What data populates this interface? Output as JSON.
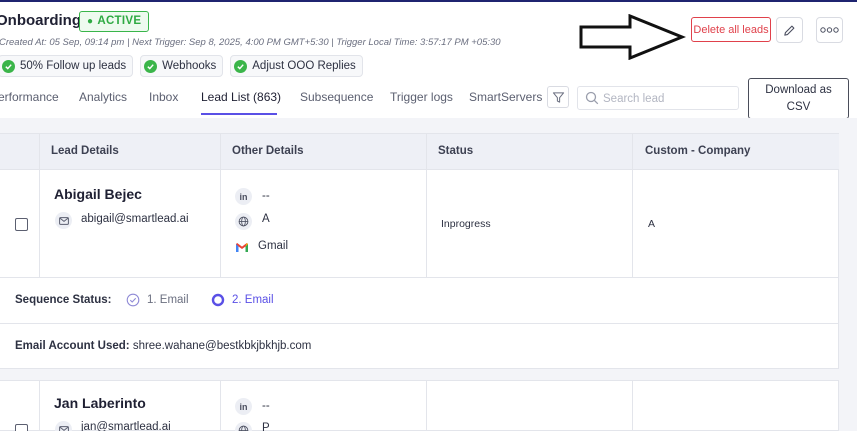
{
  "header": {
    "title": "Onboarding",
    "status_badge": "ACTIVE",
    "meta": "Created At: 05 Sep, 09:14 pm | Next Trigger: Sep 8, 2025, 4:00 PM GMT+5:30 | Trigger Local Time: 3:57:17 PM +05:30",
    "chips": [
      "50% Follow up leads",
      "Webhooks",
      "Adjust OOO Replies"
    ],
    "delete_label": "Delete all leads"
  },
  "tabs": [
    "erformance",
    "Analytics",
    "Inbox",
    "Lead List (863)",
    "Subsequence",
    "Trigger logs",
    "SmartServers"
  ],
  "active_tab": "Lead List (863)",
  "search": {
    "placeholder": "Search lead",
    "value": ""
  },
  "download_label_1": "Download as",
  "download_label_2": "CSV",
  "table": {
    "columns": [
      "Lead Details",
      "Other Details",
      "Status",
      "Custom - Company"
    ],
    "rows": [
      {
        "name": "Abigail Bejec",
        "email": "abigail@smartlead.ai",
        "linkedin": "--",
        "website": "A",
        "provider": "Gmail",
        "status": "Inprogress",
        "company": "A",
        "sequence_label": "Sequence Status:",
        "sequence_steps": [
          "1. Email",
          "2. Email"
        ],
        "email_account_label": "Email Account Used:",
        "email_account": "shree.wahane@bestkbkjbkhjb.com"
      },
      {
        "name": "Jan Laberinto",
        "email": "jan@smartlead.ai",
        "linkedin": "--",
        "website": "P"
      }
    ]
  },
  "colors": {
    "accent": "#5a50e6",
    "active_green": "#39b54a",
    "danger": "#e0414b"
  },
  "icons": [
    "check-icon",
    "arrow-right-icon",
    "pencil-icon",
    "more-icon",
    "filter-icon",
    "search-icon",
    "mail-icon",
    "linkedin-icon",
    "globe-icon",
    "gmail-icon"
  ]
}
